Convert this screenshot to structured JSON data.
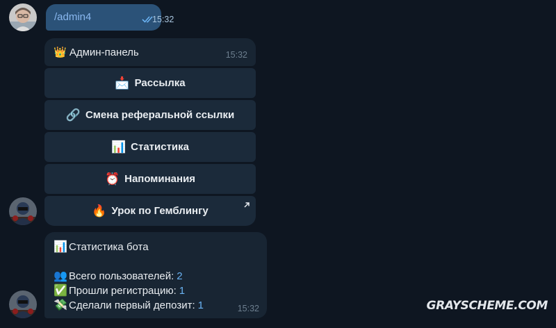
{
  "outgoing": {
    "text": "/admin4",
    "time": "15:32"
  },
  "panel": {
    "icon": "👑",
    "title": "Админ-панель",
    "time": "15:32",
    "buttons": [
      {
        "icon": "📩",
        "label": "Рассылка"
      },
      {
        "icon": "🔗",
        "label": "Смена реферальной ссылки"
      },
      {
        "icon": "📊",
        "label": "Статистика"
      },
      {
        "icon": "⏰",
        "label": "Напоминания"
      },
      {
        "icon": "🔥",
        "label": "Урок по Гемблингу"
      }
    ]
  },
  "stats": {
    "title_icon": "📊",
    "title": "Статистика бота",
    "rows": [
      {
        "icon": "👥",
        "label": "Всего пользователей:",
        "value": "2"
      },
      {
        "icon": "✅",
        "label": "Прошли регистрацию:",
        "value": "1"
      },
      {
        "icon": "💸",
        "label": "Сделали первый депозит:",
        "value": "1"
      }
    ],
    "time": "15:32"
  },
  "watermark": "GRAYSCHEME.COM",
  "colors": {
    "background": "#0e1621",
    "incoming_bubble": "#182533",
    "outgoing_bubble": "#2b5278",
    "keyboard_button": "#1b2a3a",
    "link_number": "#6ab3f3"
  }
}
